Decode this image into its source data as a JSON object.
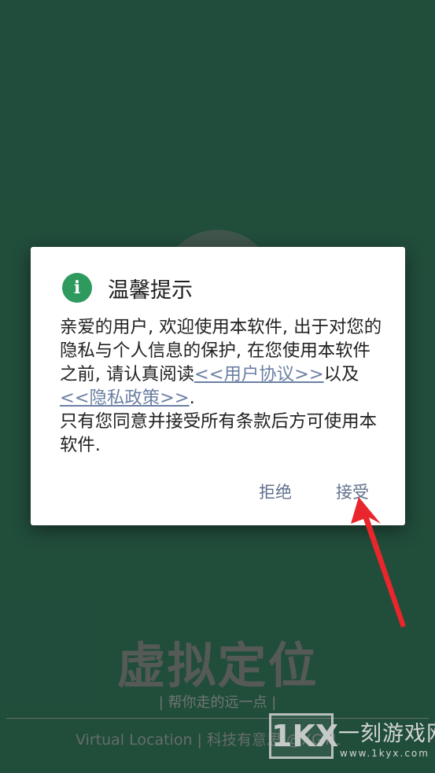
{
  "splash": {
    "brand_name": "虚拟定位",
    "slogan": "| 帮你走的远一点 |",
    "footer": "Virtual Location | 科技有意思 @XGTL"
  },
  "dialog": {
    "icon": "info-icon",
    "title": "温馨提示",
    "body_prefix": "亲爱的用户, 欢迎使用本软件, 出于对您的隐私与个人信息的保护, 在您使用本软件之前, 请认真阅读",
    "user_agreement_link": "<<用户协议>>",
    "body_middle": "以及",
    "privacy_policy_link": "<<隐私政策>>",
    "body_suffix": ".",
    "body_second": "只有您同意并接受所有条款后方可使用本软件.",
    "reject_label": "拒绝",
    "accept_label": "接受"
  },
  "watermark": {
    "logo": "1KX",
    "name": "一刻游戏网",
    "url": "www.1kyx.com"
  },
  "colors": {
    "background": "#245441",
    "icon_green": "#2e9a5e",
    "link": "#6b7fa3",
    "button_text": "#5f708c",
    "arrow": "#e8262b"
  }
}
